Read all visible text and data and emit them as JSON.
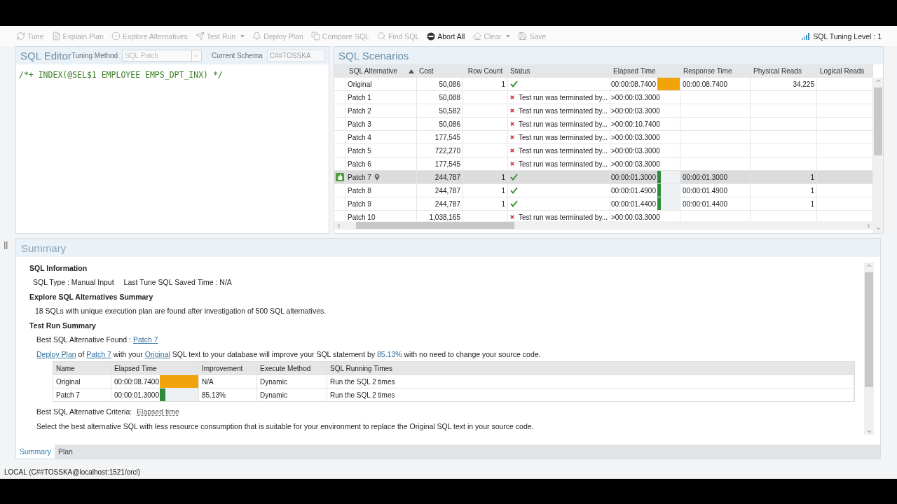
{
  "toolbar": {
    "items": [
      {
        "label": "Tune",
        "disabled": true,
        "dropdown": false
      },
      {
        "label": "Explain Plan",
        "disabled": true,
        "dropdown": false
      },
      {
        "label": "Explore Alternatives",
        "disabled": true,
        "dropdown": false
      },
      {
        "label": "Test Run",
        "disabled": true,
        "dropdown": true
      },
      {
        "label": "Deploy Plan",
        "disabled": true,
        "dropdown": false
      },
      {
        "label": "Compare SQL",
        "disabled": true,
        "dropdown": false
      },
      {
        "label": "Find SQL",
        "disabled": true,
        "dropdown": false
      },
      {
        "label": "Abort All",
        "disabled": false,
        "dropdown": false
      },
      {
        "label": "Clear",
        "disabled": true,
        "dropdown": true
      },
      {
        "label": "Save",
        "disabled": true,
        "dropdown": false
      }
    ],
    "tuning_level": "SQL Tuning Level : 1"
  },
  "sql_editor": {
    "title": "SQL Editor",
    "tuning_method_label": "Tuning Method",
    "tuning_method": "SQL Patch",
    "schema_label": "Current Schema",
    "schema": "C##TOSSKA",
    "code": "/*+ INDEX(@SEL$1 EMPLOYEE EMPS_DPT_INX) */"
  },
  "scenarios": {
    "title": "SQL Scenarios",
    "columns": [
      "SQL Alternative",
      "Cost",
      "Row Count",
      "Status",
      "Elapsed Time",
      "Response Time",
      "Physical Reads",
      "Logical Reads"
    ],
    "rows": [
      {
        "alternative": "Original",
        "cost": "50,086",
        "row_count": "1",
        "status": {
          "kind": "ok"
        },
        "elapsed": "00:00:08.7400",
        "bar": {
          "level": 1,
          "color": "#f0a30a"
        },
        "response": "00:00:08.7400",
        "physical_reads": "34,225",
        "selected": false,
        "best": false
      },
      {
        "alternative": "Patch 1",
        "cost": "50,088",
        "status": {
          "kind": "error",
          "text": "Test run was terminated by..."
        },
        "elapsed": ">00:00:03.3000",
        "selected": false,
        "best": false
      },
      {
        "alternative": "Patch 2",
        "cost": "50,582",
        "status": {
          "kind": "error",
          "text": "Test run was terminated by..."
        },
        "elapsed": ">00:00:03.3000",
        "selected": false,
        "best": false
      },
      {
        "alternative": "Patch 3",
        "cost": "50,086",
        "status": {
          "kind": "error",
          "text": "Test run was terminated by..."
        },
        "elapsed": ">00:00:10.7400",
        "selected": false,
        "best": false
      },
      {
        "alternative": "Patch 4",
        "cost": "177,545",
        "status": {
          "kind": "error",
          "text": "Test run was terminated by..."
        },
        "elapsed": ">00:00:03.3000",
        "selected": false,
        "best": false
      },
      {
        "alternative": "Patch 5",
        "cost": "722,270",
        "status": {
          "kind": "error",
          "text": "Test run was terminated by..."
        },
        "elapsed": ">00:00:03.3000",
        "selected": false,
        "best": false
      },
      {
        "alternative": "Patch 6",
        "cost": "177,545",
        "status": {
          "kind": "error",
          "text": "Test run was terminated by..."
        },
        "elapsed": ">00:00:03.3000",
        "selected": false,
        "best": false
      },
      {
        "alternative": "Patch 7",
        "cost": "244,787",
        "row_count": "1",
        "status": {
          "kind": "ok"
        },
        "elapsed": "00:00:01.3000",
        "bar": {
          "level": 0.15,
          "color": "#2e8b3a"
        },
        "response": "00:00:01.3000",
        "physical_reads": "1",
        "selected": true,
        "best": true
      },
      {
        "alternative": "Patch 8",
        "cost": "244,787",
        "row_count": "1",
        "status": {
          "kind": "ok"
        },
        "elapsed": "00:00:01.4900",
        "bar": {
          "level": 0.17,
          "color": "#2e8b3a"
        },
        "response": "00:00:01.4900",
        "physical_reads": "1",
        "selected": false,
        "best": false
      },
      {
        "alternative": "Patch 9",
        "cost": "244,787",
        "row_count": "1",
        "status": {
          "kind": "ok"
        },
        "elapsed": "00:00:01.4400",
        "bar": {
          "level": 0.16,
          "color": "#2e8b3a"
        },
        "response": "00:00:01.4400",
        "physical_reads": "1",
        "selected": false,
        "best": false
      },
      {
        "alternative": "Patch 10",
        "cost": "1,038,165",
        "status": {
          "kind": "error",
          "text": "Test run was terminated by..."
        },
        "elapsed": ">00:00:03.3000",
        "selected": false,
        "best": false
      }
    ]
  },
  "summary": {
    "title": "Summary",
    "sql_information": {
      "heading": "SQL Information",
      "sql_type": "SQL Type : Manual Input",
      "saved_time": "Last Tune SQL Saved Time : N/A"
    },
    "explore": {
      "heading": "Explore SQL Alternatives Summary",
      "text": "18 SQLs with unique execution plan are found after investigation of 500 SQL alternatives."
    },
    "test_run": {
      "heading": "Test Run Summary",
      "best_found_label": "Best SQL Alternative Found : ",
      "best_found_link": "Patch 7",
      "deploy_sentence": [
        {
          "kind": "link",
          "text": "Deploy Plan"
        },
        {
          "kind": "plain",
          "text": " of "
        },
        {
          "kind": "link",
          "text": "Patch 7"
        },
        {
          "kind": "plain",
          "text": " with your "
        },
        {
          "kind": "link",
          "text": "Original"
        },
        {
          "kind": "plain",
          "text": " SQL text to your database will improve your SQL statement by "
        },
        {
          "kind": "highlight",
          "text": "85.13%"
        },
        {
          "kind": "plain",
          "text": " with no need to change your source code."
        }
      ],
      "table": {
        "columns": [
          "Name",
          "Elapsed Time",
          "Improvement",
          "Execute Method",
          "SQL Running Times"
        ],
        "rows": [
          {
            "name": "Original",
            "elapsed": "00:00:08.7400",
            "bar": {
              "level": 1,
              "color": "#f0a30a"
            },
            "improvement": "N/A",
            "method": "Dynamic",
            "running": "Run the SQL 2  times"
          },
          {
            "name": "Patch 7",
            "elapsed": "00:00:01.3000",
            "bar": {
              "level": 0.15,
              "color": "#2e8b3a"
            },
            "improvement": "85.13%",
            "method": "Dynamic",
            "running": "Run the SQL 2  times"
          }
        ]
      },
      "criteria_label": "Best SQL Alternative Criteria: ",
      "criteria_value": "Elapsed time",
      "note": "Select the best alternative SQL with less resource consumption that is suitable for your environment to replace the Original SQL text in your source code."
    },
    "tabs": [
      {
        "label": "Summary",
        "selected": true
      },
      {
        "label": "Plan",
        "selected": false
      }
    ]
  },
  "status_bar": "LOCAL (C##TOSSKA@localhost:1521/orcl)"
}
